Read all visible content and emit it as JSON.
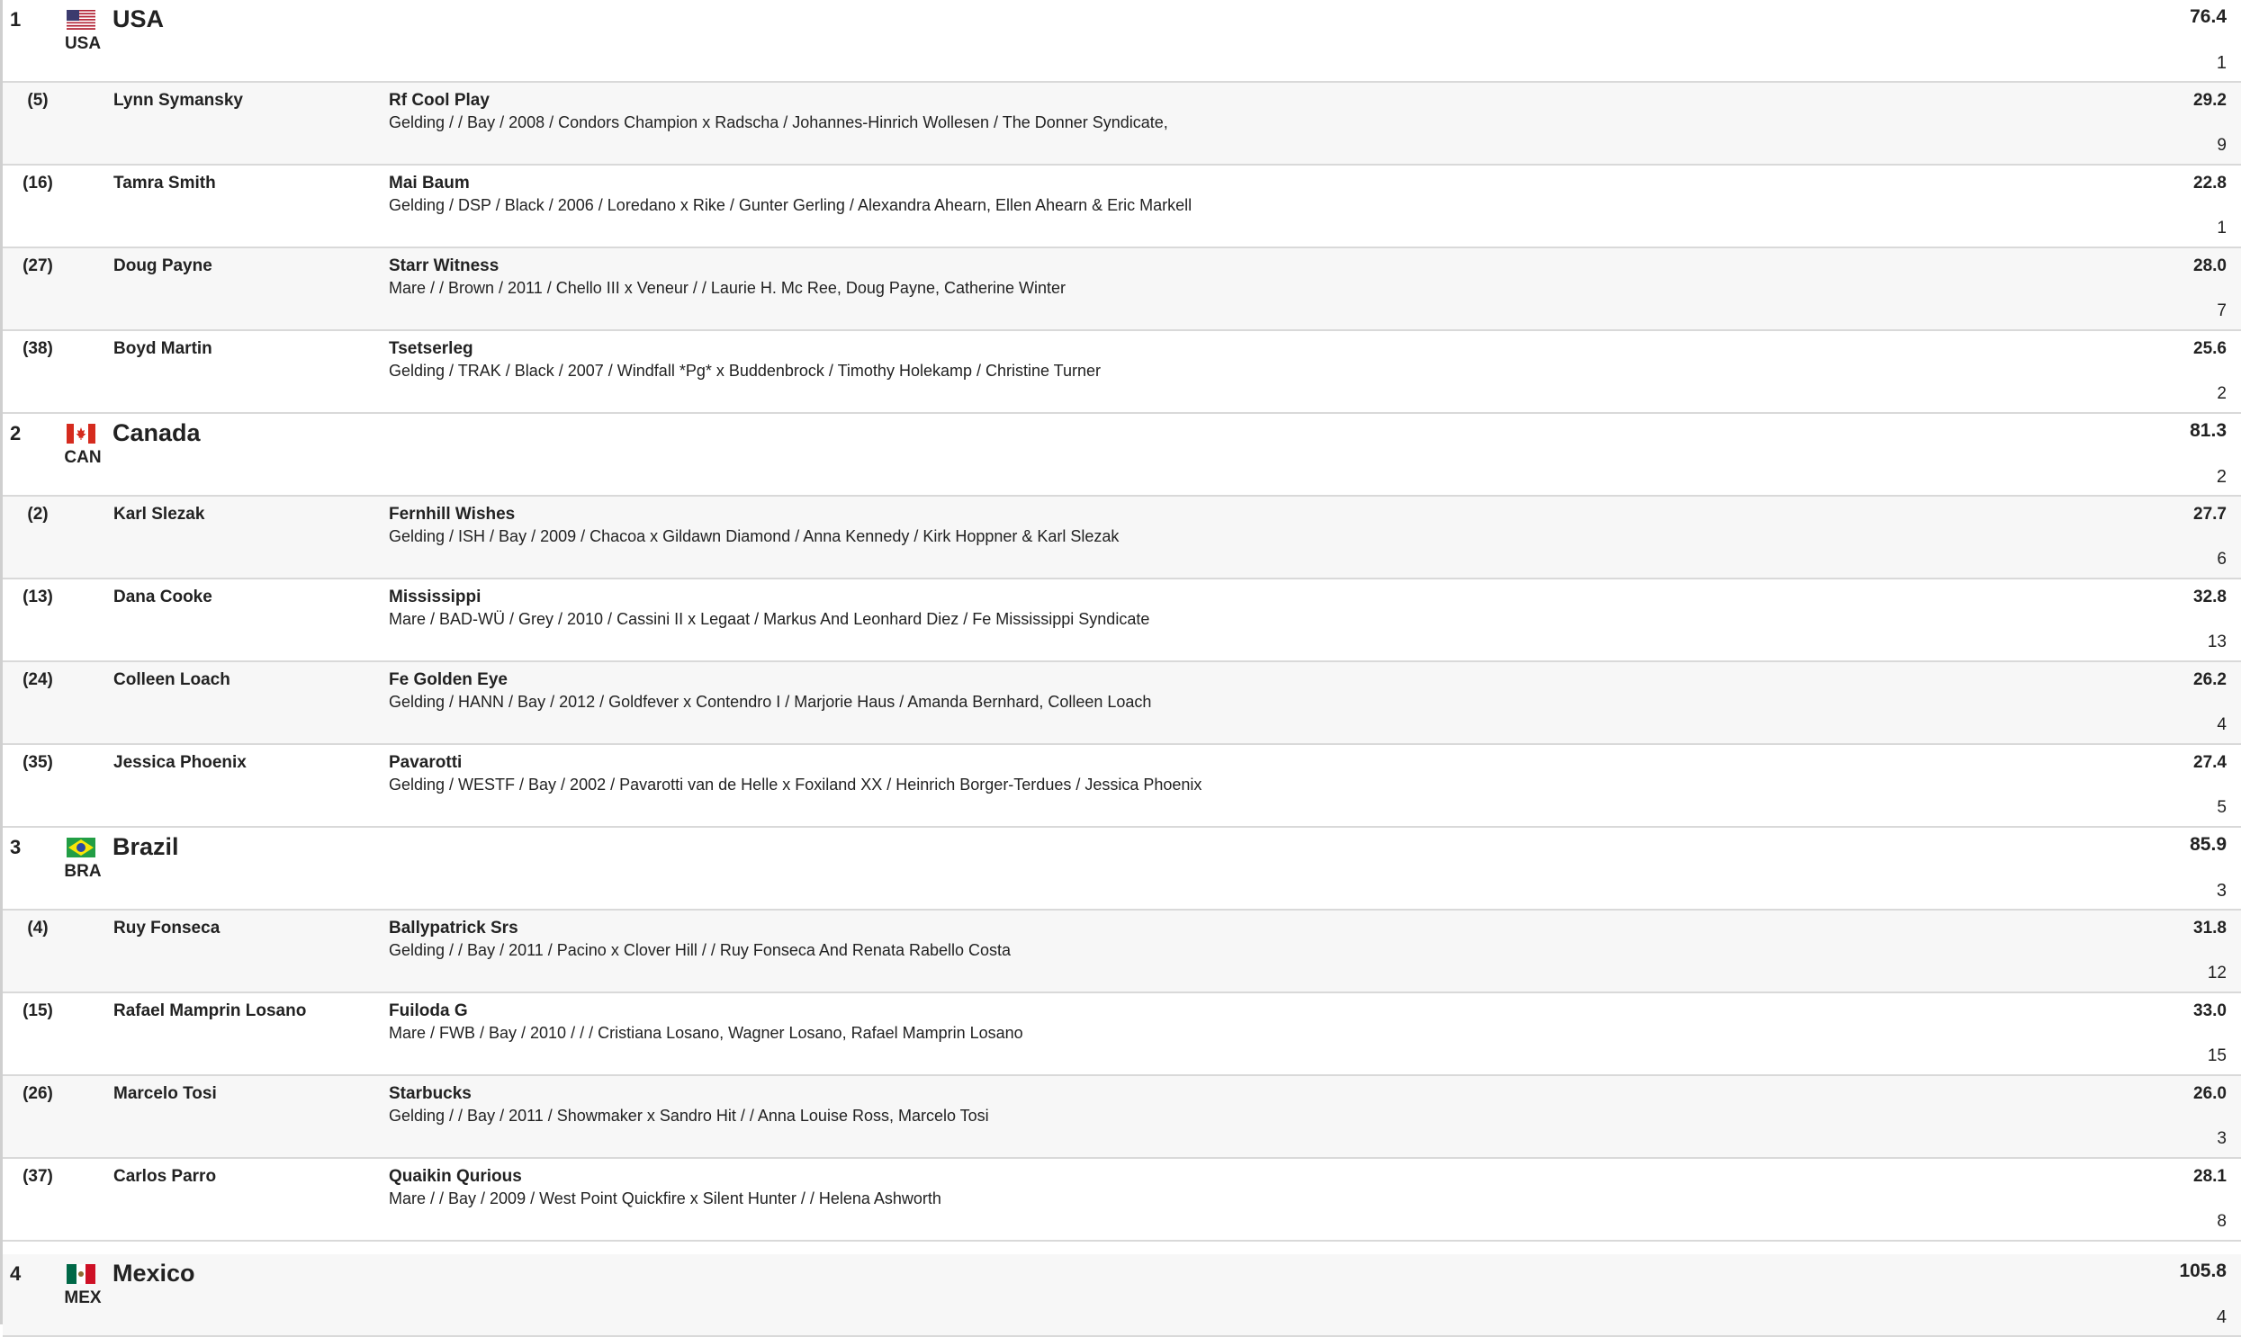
{
  "teams": [
    {
      "rank": "1",
      "code": "USA",
      "name": "USA",
      "score": "76.4",
      "place": "1",
      "flag": "usa-flag",
      "riders": [
        {
          "start": "(5)",
          "rider": "Lynn Symansky",
          "horse": "Rf Cool Play",
          "desc": "Gelding / / Bay / 2008 / Condors Champion x Radscha / Johannes-Hinrich Wollesen / The Donner Syndicate,",
          "score": "29.2",
          "place": "9"
        },
        {
          "start": "(16)",
          "rider": "Tamra Smith",
          "horse": "Mai Baum",
          "desc": "Gelding / DSP / Black / 2006 / Loredano x Rike / Gunter Gerling / Alexandra Ahearn, Ellen Ahearn & Eric Markell",
          "score": "22.8",
          "place": "1"
        },
        {
          "start": "(27)",
          "rider": "Doug Payne",
          "horse": "Starr Witness",
          "desc": "Mare / / Brown / 2011 / Chello III x Veneur / / Laurie H. Mc Ree, Doug Payne, Catherine Winter",
          "score": "28.0",
          "place": "7"
        },
        {
          "start": "(38)",
          "rider": "Boyd Martin",
          "horse": "Tsetserleg",
          "desc": "Gelding / TRAK / Black / 2007 / Windfall *Pg* x Buddenbrock / Timothy Holekamp / Christine Turner",
          "score": "25.6",
          "place": "2"
        }
      ]
    },
    {
      "rank": "2",
      "code": "CAN",
      "name": "Canada",
      "score": "81.3",
      "place": "2",
      "flag": "canada-flag",
      "riders": [
        {
          "start": "(2)",
          "rider": "Karl Slezak",
          "horse": "Fernhill Wishes",
          "desc": "Gelding / ISH / Bay / 2009 / Chacoa x Gildawn Diamond / Anna Kennedy / Kirk Hoppner & Karl Slezak",
          "score": "27.7",
          "place": "6"
        },
        {
          "start": "(13)",
          "rider": "Dana Cooke",
          "horse": "Mississippi",
          "desc": "Mare / BAD-WÜ / Grey / 2010 / Cassini II x Legaat / Markus And Leonhard Diez / Fe Mississippi Syndicate",
          "score": "32.8",
          "place": "13"
        },
        {
          "start": "(24)",
          "rider": "Colleen Loach",
          "horse": "Fe Golden Eye",
          "desc": "Gelding / HANN / Bay / 2012 / Goldfever x Contendro I / Marjorie Haus / Amanda Bernhard, Colleen Loach",
          "score": "26.2",
          "place": "4"
        },
        {
          "start": "(35)",
          "rider": "Jessica Phoenix",
          "horse": "Pavarotti",
          "desc": "Gelding / WESTF / Bay / 2002 / Pavarotti van de Helle x Foxiland XX / Heinrich Borger-Terdues / Jessica Phoenix",
          "score": "27.4",
          "place": "5"
        }
      ]
    },
    {
      "rank": "3",
      "code": "BRA",
      "name": "Brazil",
      "score": "85.9",
      "place": "3",
      "flag": "brazil-flag",
      "riders": [
        {
          "start": "(4)",
          "rider": "Ruy Fonseca",
          "horse": "Ballypatrick Srs",
          "desc": "Gelding / / Bay / 2011 / Pacino x Clover Hill / / Ruy Fonseca And Renata Rabello Costa",
          "score": "31.8",
          "place": "12"
        },
        {
          "start": "(15)",
          "rider": "Rafael Mamprin Losano",
          "horse": "Fuiloda G",
          "desc": "Mare / FWB / Bay / 2010 / / / Cristiana Losano, Wagner Losano, Rafael Mamprin Losano",
          "score": "33.0",
          "place": "15"
        },
        {
          "start": "(26)",
          "rider": "Marcelo Tosi",
          "horse": "Starbucks",
          "desc": "Gelding / / Bay / 2011 / Showmaker x Sandro Hit / / Anna Louise Ross, Marcelo Tosi",
          "score": "26.0",
          "place": "3"
        },
        {
          "start": "(37)",
          "rider": "Carlos Parro",
          "horse": "Quaikin Qurious",
          "desc": "Mare / / Bay / 2009 / West Point Quickfire x Silent Hunter / / Helena Ashworth",
          "score": "28.1",
          "place": "8"
        }
      ]
    },
    {
      "rank": "4",
      "code": "MEX",
      "name": "Mexico",
      "score": "105.8",
      "place": "4",
      "flag": "mexico-flag",
      "riders": []
    }
  ]
}
